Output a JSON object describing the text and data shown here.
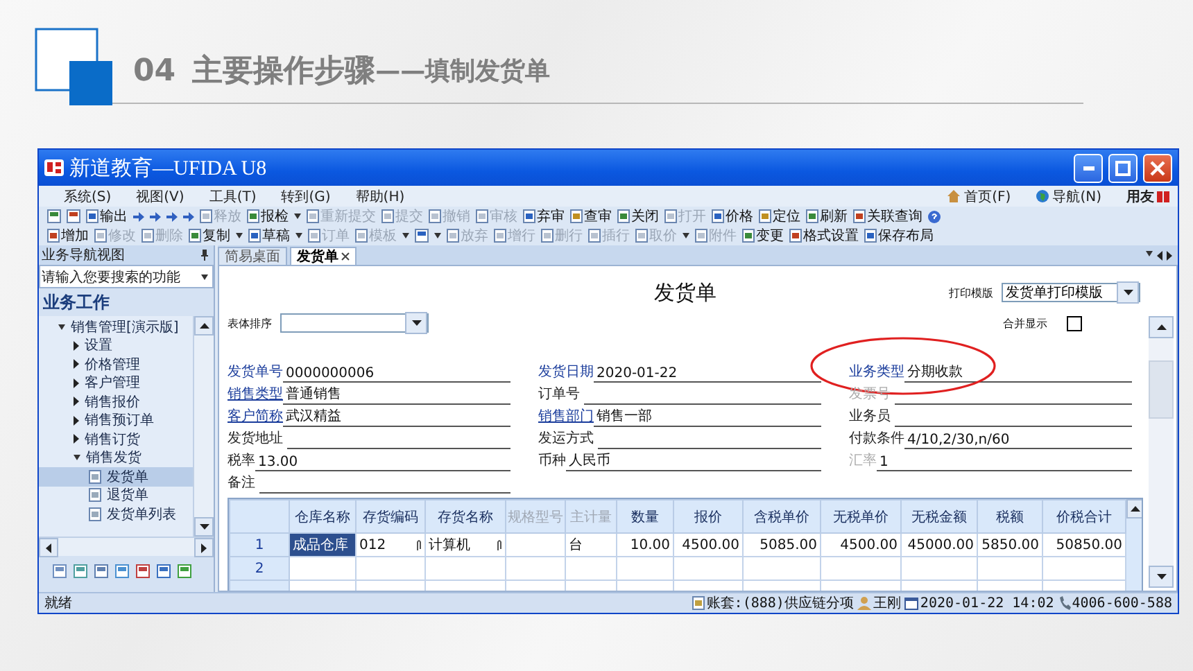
{
  "slide": {
    "number": "04",
    "title": "主要操作步骤",
    "subtitle": "——填制发货单"
  },
  "window": {
    "title": "新道教育—UFIDA U8"
  },
  "menu": [
    "系统(S)",
    "视图(V)",
    "工具(T)",
    "转到(G)",
    "帮助(H)"
  ],
  "menu_right": [
    {
      "label": "首页(F)",
      "kind": "home"
    },
    {
      "label": "导航(N)",
      "kind": "globe"
    }
  ],
  "brand": "用友",
  "toolbar_rows": [
    [
      {
        "kind": "icon"
      },
      {
        "kind": "icon"
      },
      {
        "kind": "button",
        "label": "输出",
        "disabled": false
      },
      {
        "kind": "nav"
      },
      {
        "kind": "nav"
      },
      {
        "kind": "nav"
      },
      {
        "kind": "nav"
      },
      {
        "kind": "button",
        "label": "释放",
        "disabled": true
      },
      {
        "kind": "button",
        "label": "报检",
        "disabled": false
      },
      {
        "kind": "caret"
      },
      {
        "kind": "button",
        "label": "重新提交",
        "disabled": true
      },
      {
        "kind": "button",
        "label": "提交",
        "disabled": true
      },
      {
        "kind": "button",
        "label": "撤销",
        "disabled": true
      },
      {
        "kind": "button",
        "label": "审核",
        "disabled": true
      },
      {
        "kind": "button",
        "label": "弃审",
        "disabled": false
      },
      {
        "kind": "button",
        "label": "查审",
        "disabled": false
      },
      {
        "kind": "button",
        "label": "关闭",
        "disabled": false
      },
      {
        "kind": "button",
        "label": "打开",
        "disabled": true
      },
      {
        "kind": "button",
        "label": "价格",
        "disabled": false
      },
      {
        "kind": "button",
        "label": "定位",
        "disabled": false
      },
      {
        "kind": "button",
        "label": "刷新",
        "disabled": false
      },
      {
        "kind": "button",
        "label": "关联查询",
        "disabled": false
      },
      {
        "kind": "help"
      }
    ],
    [
      {
        "kind": "button",
        "label": "增加",
        "disabled": false
      },
      {
        "kind": "button",
        "label": "修改",
        "disabled": true
      },
      {
        "kind": "button",
        "label": "删除",
        "disabled": true
      },
      {
        "kind": "button",
        "label": "复制",
        "disabled": false
      },
      {
        "kind": "caret"
      },
      {
        "kind": "button",
        "label": "草稿",
        "disabled": false
      },
      {
        "kind": "caret"
      },
      {
        "kind": "button",
        "label": "订单",
        "disabled": true
      },
      {
        "kind": "button",
        "label": "模板",
        "disabled": true
      },
      {
        "kind": "caret"
      },
      {
        "kind": "icon"
      },
      {
        "kind": "caret"
      },
      {
        "kind": "button",
        "label": "放弃",
        "disabled": true
      },
      {
        "kind": "button",
        "label": "增行",
        "disabled": true
      },
      {
        "kind": "button",
        "label": "删行",
        "disabled": true
      },
      {
        "kind": "button",
        "label": "插行",
        "disabled": true
      },
      {
        "kind": "button",
        "label": "取价",
        "disabled": true
      },
      {
        "kind": "caret"
      },
      {
        "kind": "button",
        "label": "附件",
        "disabled": true
      },
      {
        "kind": "button",
        "label": "变更",
        "disabled": false
      },
      {
        "kind": "button",
        "label": "格式设置",
        "disabled": false
      },
      {
        "kind": "button",
        "label": "保存布局",
        "disabled": false
      }
    ]
  ],
  "nav": {
    "header": "业务导航视图",
    "search": "请输入您要搜索的功能",
    "section": "业务工作",
    "tree": [
      {
        "label": "销售管理[演示版]",
        "kind": "group",
        "expanded": true,
        "children": [
          {
            "label": "设置",
            "kind": "group",
            "expanded": false
          },
          {
            "label": "价格管理",
            "kind": "group",
            "expanded": false
          },
          {
            "label": "客户管理",
            "kind": "group",
            "expanded": false
          },
          {
            "label": "销售报价",
            "kind": "group",
            "expanded": false
          },
          {
            "label": "销售预订单",
            "kind": "group",
            "expanded": false
          },
          {
            "label": "销售订货",
            "kind": "group",
            "expanded": false
          },
          {
            "label": "销售发货",
            "kind": "group",
            "expanded": true,
            "children": [
              {
                "label": "发货单",
                "kind": "page",
                "selected": true
              },
              {
                "label": "退货单",
                "kind": "page",
                "selected": false
              },
              {
                "label": "发货单列表",
                "kind": "page",
                "selected": false
              }
            ]
          }
        ]
      }
    ]
  },
  "tabs": [
    {
      "label": "简易桌面",
      "selected": false,
      "closable": false
    },
    {
      "label": "发货单",
      "selected": true,
      "closable": true
    }
  ],
  "form": {
    "title": "发货单",
    "print_label": "打印模版",
    "print_template": "发货单打印模版",
    "sort_label": "表体排序",
    "merge_label": "合并显示",
    "merge_checked": false,
    "rows": [
      [
        {
          "label": "发货单号",
          "value": "0000000006",
          "kind": "required"
        },
        {
          "label": "发货日期",
          "value": "2020-01-22",
          "kind": "required"
        },
        {
          "label": "业务类型",
          "value": "分期收款",
          "kind": "required",
          "circled": true
        }
      ],
      [
        {
          "label": "销售类型",
          "value": "普通销售",
          "kind": "link"
        },
        {
          "label": "订单号",
          "kind": "plain"
        },
        {
          "label": "发票号",
          "kind": "disabled"
        }
      ],
      [
        {
          "label": "客户简称",
          "value": "武汉精益",
          "kind": "link"
        },
        {
          "label": "销售部门",
          "value": "销售一部",
          "kind": "link"
        },
        {
          "label": "业务员",
          "kind": "plain"
        }
      ],
      [
        {
          "label": "发货地址",
          "kind": "plain"
        },
        {
          "label": "发运方式",
          "kind": "plain"
        },
        {
          "label": "付款条件",
          "value": "4/10,2/30,n/60",
          "kind": "plain"
        }
      ],
      [
        {
          "label": "税率",
          "value": "13.00",
          "kind": "plain"
        },
        {
          "label": "币种",
          "value": "人民币",
          "kind": "plain"
        },
        {
          "label": "汇率",
          "value": "1",
          "kind": "disabled"
        }
      ],
      [
        {
          "label": "备注",
          "kind": "plain"
        }
      ]
    ]
  },
  "table": {
    "columns": [
      {
        "label": "仓库名称",
        "disabled": false
      },
      {
        "label": "存货编码",
        "disabled": false,
        "lookup": true
      },
      {
        "label": "存货名称",
        "disabled": false,
        "lookup": true
      },
      {
        "label": "规格型号",
        "disabled": true
      },
      {
        "label": "主计量",
        "disabled": true
      },
      {
        "label": "数量",
        "disabled": false,
        "numeric": true
      },
      {
        "label": "报价",
        "disabled": false,
        "numeric": true
      },
      {
        "label": "含税单价",
        "disabled": false,
        "numeric": true
      },
      {
        "label": "无税单价",
        "disabled": false,
        "numeric": true
      },
      {
        "label": "无税金额",
        "disabled": false,
        "numeric": true
      },
      {
        "label": "税额",
        "disabled": false,
        "numeric": true
      },
      {
        "label": "价税合计",
        "disabled": false,
        "numeric": true
      }
    ],
    "rows": [
      {
        "number": "1",
        "selected": true,
        "cells": [
          "成品仓库",
          "012",
          "计算机",
          "",
          "台",
          "10.00",
          "4500.00",
          "5085.00",
          "4500.00",
          "45000.00",
          "5850.00",
          "50850.00"
        ]
      },
      {
        "number": "2",
        "selected": false,
        "cells": []
      }
    ]
  },
  "status": {
    "left": "就绪",
    "items": [
      {
        "text": "账套:(888)供应链分项",
        "kind": "book"
      },
      {
        "text": "王刚",
        "kind": "user"
      },
      {
        "text": "2020-01-22 14:02",
        "kind": "calendar"
      },
      {
        "text": "4006-600-588",
        "kind": "phone"
      }
    ]
  }
}
